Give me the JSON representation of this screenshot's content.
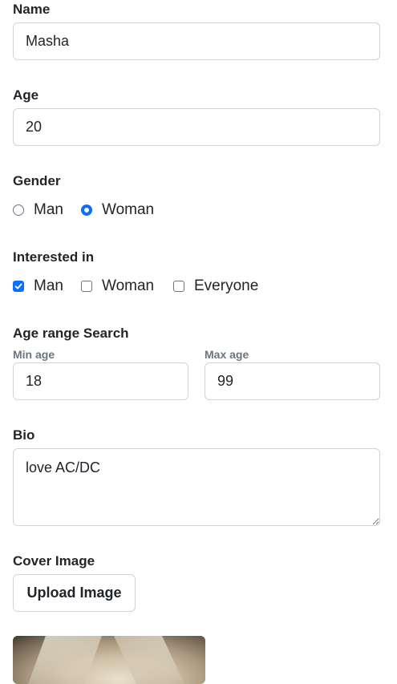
{
  "name": {
    "label": "Name",
    "value": "Masha"
  },
  "age": {
    "label": "Age",
    "value": "20"
  },
  "gender": {
    "label": "Gender",
    "options": [
      {
        "label": "Man",
        "checked": false
      },
      {
        "label": "Woman",
        "checked": true
      }
    ]
  },
  "interested": {
    "label": "Interested in",
    "options": [
      {
        "label": "Man",
        "checked": true
      },
      {
        "label": "Woman",
        "checked": false
      },
      {
        "label": "Everyone",
        "checked": false
      }
    ]
  },
  "age_range": {
    "label": "Age range Search",
    "min_label": "Min age",
    "min_value": "18",
    "max_label": "Max age",
    "max_value": "99"
  },
  "bio": {
    "label": "Bio",
    "value": "love AC/DC"
  },
  "cover": {
    "label": "Cover Image",
    "upload_label": "Upload Image"
  },
  "colors": {
    "accent": "#0d6efd",
    "border": "#ced4da",
    "text": "#212529",
    "muted": "#6c757d"
  }
}
